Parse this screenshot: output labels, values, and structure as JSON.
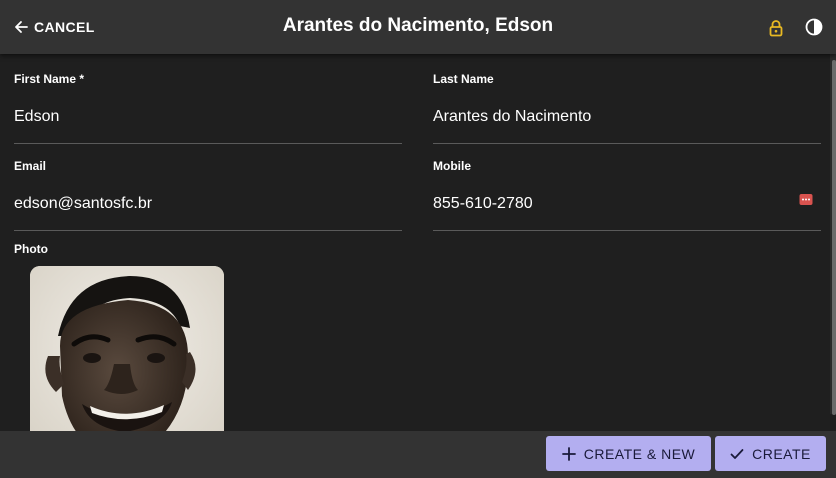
{
  "header": {
    "cancel_label": "CANCEL",
    "title": "Arantes do Nacimento, Edson",
    "lock_color": "#e8b923"
  },
  "form": {
    "first_name": {
      "label": "First Name *",
      "value": "Edson"
    },
    "last_name": {
      "label": "Last Name",
      "value": "Arantes do Nacimento"
    },
    "email": {
      "label": "Email",
      "value": "edson@santosfc.br"
    },
    "mobile": {
      "label": "Mobile",
      "value": "855-610-2780",
      "action_icon": "sms-icon",
      "action_color": "#d9534f"
    },
    "photo": {
      "label": "Photo"
    }
  },
  "footer": {
    "create_new_label": "CREATE & NEW",
    "create_label": "CREATE",
    "button_color": "#b3aef0"
  }
}
